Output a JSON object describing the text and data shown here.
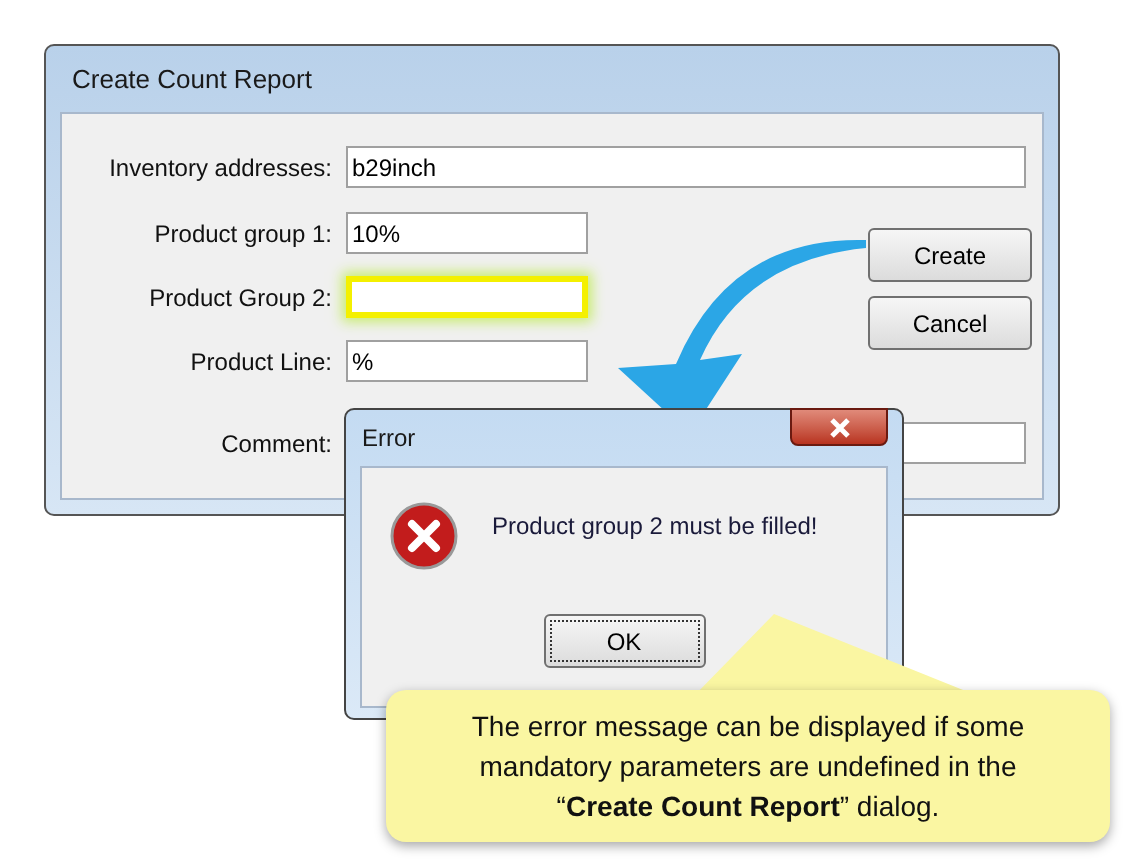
{
  "dialog": {
    "title": "Create Count Report",
    "fields": [
      {
        "label": "Inventory addresses:",
        "value": "b29inch",
        "highlighted": false,
        "wide": true
      },
      {
        "label": "Product group 1:",
        "value": "10%",
        "highlighted": false,
        "wide": false
      },
      {
        "label": "Product Group 2:",
        "highlighted": true,
        "wide": false
      },
      {
        "label": "Product Line:",
        "value": "%",
        "highlighted": false,
        "wide": false
      },
      {
        "label": "Comment:",
        "highlighted": false,
        "wide": true
      }
    ],
    "buttons": [
      "Create",
      "Cancel"
    ]
  },
  "error_dialog": {
    "title": "Error",
    "message": "Product group 2 must be filled!",
    "button": "OK"
  },
  "callout": {
    "text": "The error message can be displayed if some mandatory parameters are undefined in the “**Create Count Report**” dialog."
  }
}
